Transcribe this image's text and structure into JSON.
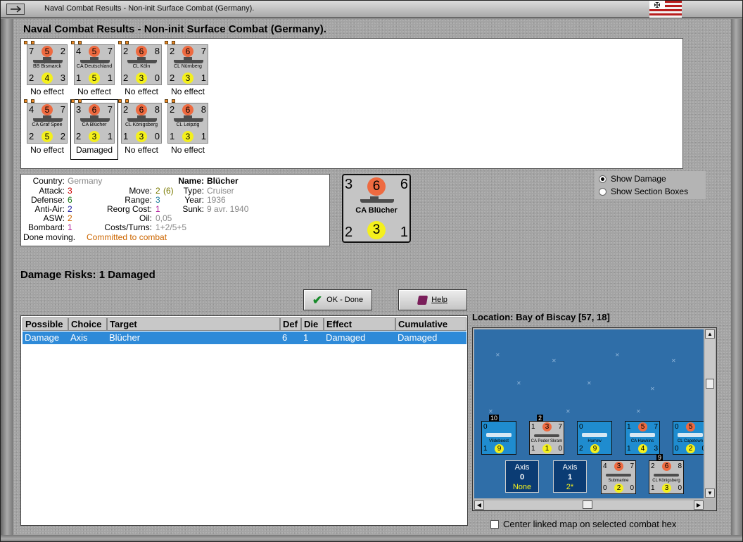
{
  "window": {
    "title": "Naval Combat Results - Non-init Surface Combat (Germany)."
  },
  "heading": "Naval Combat Results - Non-init Surface Combat (Germany).",
  "ships": [
    {
      "name": "BB Bismarck",
      "tl": "7",
      "top": "5",
      "tr": "2",
      "bl": "2",
      "bot": "4",
      "br": "3",
      "result": "No effect"
    },
    {
      "name": "CA Deutschland",
      "tl": "4",
      "top": "5",
      "tr": "7",
      "bl": "1",
      "bot": "5",
      "br": "1",
      "result": "No effect"
    },
    {
      "name": "CL Köln",
      "tl": "2",
      "top": "6",
      "tr": "8",
      "bl": "2",
      "bot": "3",
      "br": "0",
      "result": "No effect"
    },
    {
      "name": "CL Nürnberg",
      "tl": "2",
      "top": "6",
      "tr": "7",
      "bl": "2",
      "bot": "3",
      "br": "1",
      "result": "No effect"
    },
    {
      "name": "CA Graf Spee",
      "tl": "4",
      "top": "5",
      "tr": "7",
      "bl": "2",
      "bot": "5",
      "br": "2",
      "result": "No effect"
    },
    {
      "name": "CA Blücher",
      "tl": "3",
      "top": "6",
      "tr": "7",
      "bl": "2",
      "bot": "3",
      "br": "1",
      "result": "Damaged"
    },
    {
      "name": "CL Königsberg",
      "tl": "2",
      "top": "6",
      "tr": "8",
      "bl": "1",
      "bot": "3",
      "br": "0",
      "result": "No effect"
    },
    {
      "name": "CL Leipzig",
      "tl": "2",
      "top": "6",
      "tr": "8",
      "bl": "1",
      "bot": "3",
      "br": "1",
      "result": "No effect"
    }
  ],
  "info": {
    "labels": {
      "country": "Country:",
      "attack": "Attack:",
      "defense": "Defense:",
      "antiair": "Anti-Air:",
      "asw": "ASW:",
      "bombard": "Bombard:",
      "move": "Move:",
      "range": "Range:",
      "reorg": "Reorg Cost:",
      "oil": "Oil:",
      "costs": "Costs/Turns:",
      "name": "Name:",
      "type": "Type:",
      "year": "Year:",
      "sunk": "Sunk:"
    },
    "country": "Germany",
    "attack": "3",
    "defense": "6",
    "antiair": "2",
    "asw": "2",
    "bombard": "1",
    "move": "2",
    "move_extra": "(6)",
    "range": "3",
    "reorg": "1",
    "oil": "0,05",
    "costs": "1+2/5+5",
    "name": "Blücher",
    "type": "Cruiser",
    "year": "1936",
    "sunk": "9 avr. 1940",
    "status": "Done moving.",
    "status_extra": "Committed to combat"
  },
  "big_counter": {
    "name": "CA Blücher",
    "tl": "3",
    "top": "6",
    "tr": "6",
    "bl": "2",
    "bot": "3",
    "br": "1"
  },
  "options": {
    "show_damage": "Show Damage",
    "show_sections": "Show Section Boxes"
  },
  "risks": "Damage Risks:  1 Damaged",
  "buttons": {
    "ok": "OK - Done",
    "help": "Help"
  },
  "table": {
    "headers": [
      "Possible",
      "Choice",
      "Target",
      "Def",
      "Die",
      "Effect",
      "Cumulative"
    ],
    "rows": [
      [
        "Damage",
        "Axis",
        "Blücher",
        "6",
        "1",
        "Damaged",
        "Damaged"
      ]
    ]
  },
  "location": "Location:  Bay of Biscay [57, 18]",
  "map": {
    "units": [
      {
        "name": "Vildebeest",
        "tag": "10",
        "tl": "0",
        "bot": "9",
        "br": "",
        "bl": "1",
        "top": "",
        "tr": ""
      },
      {
        "name": "CA Peder Skram",
        "tag": "2",
        "tl": "1",
        "top": "3",
        "tr": "7",
        "bl": "1",
        "bot": "1",
        "br": "0"
      },
      {
        "name": "Harrow",
        "tag": "",
        "tl": "0",
        "top": "",
        "tr": "",
        "bl": "2",
        "bot": "9",
        "br": ""
      },
      {
        "name": "CA Hawkins",
        "tag": "",
        "tl": "1",
        "top": "5",
        "tr": "7",
        "bl": "1",
        "bot": "4",
        "br": "3"
      },
      {
        "name": "CL Capetown",
        "tag": "",
        "tl": "0",
        "top": "5",
        "tr": "",
        "bl": "0",
        "bot": "2",
        "br": "0"
      },
      {
        "name": "Submarine",
        "tag": "",
        "tl": "4",
        "top": "3",
        "tr": "7",
        "bl": "0",
        "bot": "2",
        "br": "0"
      },
      {
        "name": "CL Königsberg",
        "tag": "9",
        "tl": "2",
        "top": "6",
        "tr": "8",
        "bl": "1",
        "bot": "3",
        "br": "0"
      }
    ],
    "axis_boxes": [
      {
        "label": "Axis",
        "value": "0",
        "sub": "None"
      },
      {
        "label": "Axis",
        "value": "1",
        "sub": "2*"
      }
    ]
  },
  "center_label": "Center linked map on selected combat hex",
  "colors": {
    "selection": "#2e8ad8",
    "attack": "#cc0000",
    "defense": "#1a7a1a",
    "blue": "#1a1aa0",
    "orange": "#cc6600",
    "purple": "#b0189a"
  }
}
